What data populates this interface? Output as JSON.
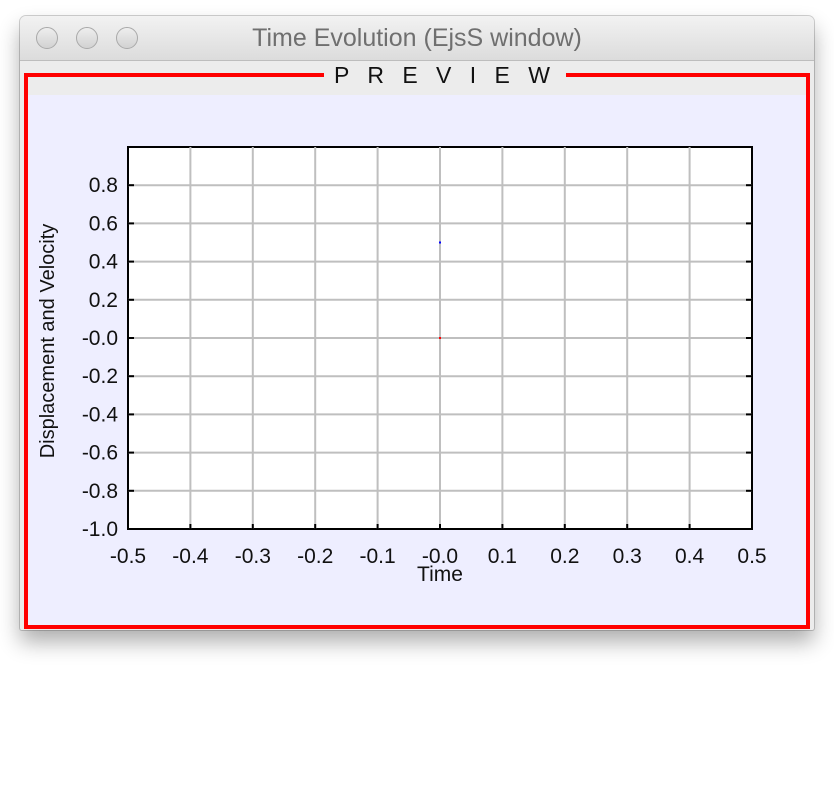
{
  "window": {
    "title": "Time Evolution (EjsS window)",
    "panel_label": "P R E V I E W"
  },
  "colors": {
    "panel_border": "#ff0000",
    "plot_background": "#eeeeff",
    "displacement": "#ff0000",
    "velocity": "#0000ff"
  },
  "chart_data": {
    "type": "scatter",
    "xlabel": "Time",
    "ylabel": "Displacement and Velocity",
    "xlim": [
      -0.5,
      0.5
    ],
    "ylim": [
      -1.0,
      1.0
    ],
    "x_ticks": [
      "-0.5",
      "-0.4",
      "-0.3",
      "-0.2",
      "-0.1",
      "-0.0",
      "0.1",
      "0.2",
      "0.3",
      "0.4",
      "0.5"
    ],
    "y_ticks": [
      "0.8",
      "0.6",
      "0.4",
      "0.2",
      "-0.0",
      "-0.2",
      "-0.4",
      "-0.6",
      "-0.8",
      "-1.0"
    ],
    "grid": true,
    "series": [
      {
        "color": "#ff0000",
        "points": [
          [
            0.0,
            0.0
          ]
        ]
      },
      {
        "color": "#0000ff",
        "points": [
          [
            0.0,
            0.5
          ]
        ]
      }
    ]
  }
}
